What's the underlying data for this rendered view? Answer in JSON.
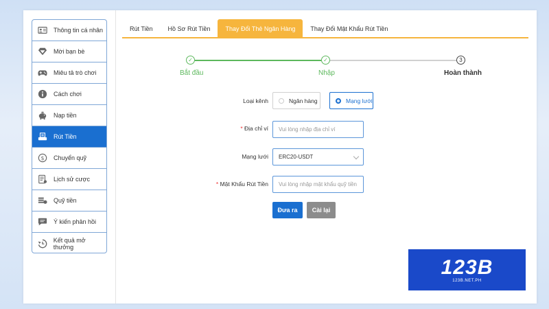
{
  "sidebar": {
    "items": [
      {
        "label": "Thông tin cá nhân",
        "icon": "user-card-icon",
        "active": false
      },
      {
        "label": "Mời bạn bè",
        "icon": "diamond-icon",
        "active": false
      },
      {
        "label": "Miêu tả trò chơi",
        "icon": "gamepad-icon",
        "active": false
      },
      {
        "label": "Cách chơi",
        "icon": "info-icon",
        "active": false
      },
      {
        "label": "Nạp tiền",
        "icon": "piggy-bank-icon",
        "active": false
      },
      {
        "label": "Rút Tiền",
        "icon": "withdraw-icon",
        "active": true
      },
      {
        "label": "Chuyển quỹ",
        "icon": "dollar-coin-icon",
        "active": false
      },
      {
        "label": "Lịch sử cược",
        "icon": "history-list-icon",
        "active": false
      },
      {
        "label": "Quỹ tiền",
        "icon": "money-stack-icon",
        "active": false
      },
      {
        "label": "Ý kiến phản hồi",
        "icon": "chat-bubble-icon",
        "active": false
      },
      {
        "label": "Kết quả mở thưởng",
        "icon": "clock-history-icon",
        "active": false
      }
    ],
    "accent": "#1a6fd0"
  },
  "tabs": [
    {
      "label": "Rút Tiền",
      "active": false
    },
    {
      "label": "Hồ Sơ Rút Tiền",
      "active": false
    },
    {
      "label": "Thay Đổi Thẻ Ngân Hàng",
      "active": true
    },
    {
      "label": "Thay Đổi Mật Khẩu Rút Tiền",
      "active": false
    }
  ],
  "steps": [
    {
      "label": "Bắt đầu",
      "status": "done",
      "mark": "✓"
    },
    {
      "label": "Nhập",
      "status": "done",
      "mark": "✓"
    },
    {
      "label": "Hoàn thành",
      "status": "pending",
      "mark": "3"
    }
  ],
  "form": {
    "channel_label": "Loại kênh",
    "channel_options": [
      {
        "label": "Ngân hàng",
        "selected": false
      },
      {
        "label": "Mạng lưới",
        "selected": true
      }
    ],
    "wallet_label": "Địa chỉ ví",
    "wallet_placeholder": "Vui lòng nhập địa chỉ ví",
    "wallet_required": "*",
    "network_label": "Mạng lưới",
    "network_value": "ERC20-USDT",
    "password_label": "Mật Khẩu Rút Tiền",
    "password_placeholder": "Vui lòng nhập mật khẩu quỹ tiền",
    "password_required": "*",
    "submit_label": "Đưa ra",
    "reset_label": "Cài lại"
  },
  "logo": {
    "main": "123B",
    "sub": "123B.NET.PH"
  },
  "colors": {
    "tab_active": "#f6b53d",
    "step_done": "#5cb85c",
    "logo_bg": "#1a49c9"
  }
}
